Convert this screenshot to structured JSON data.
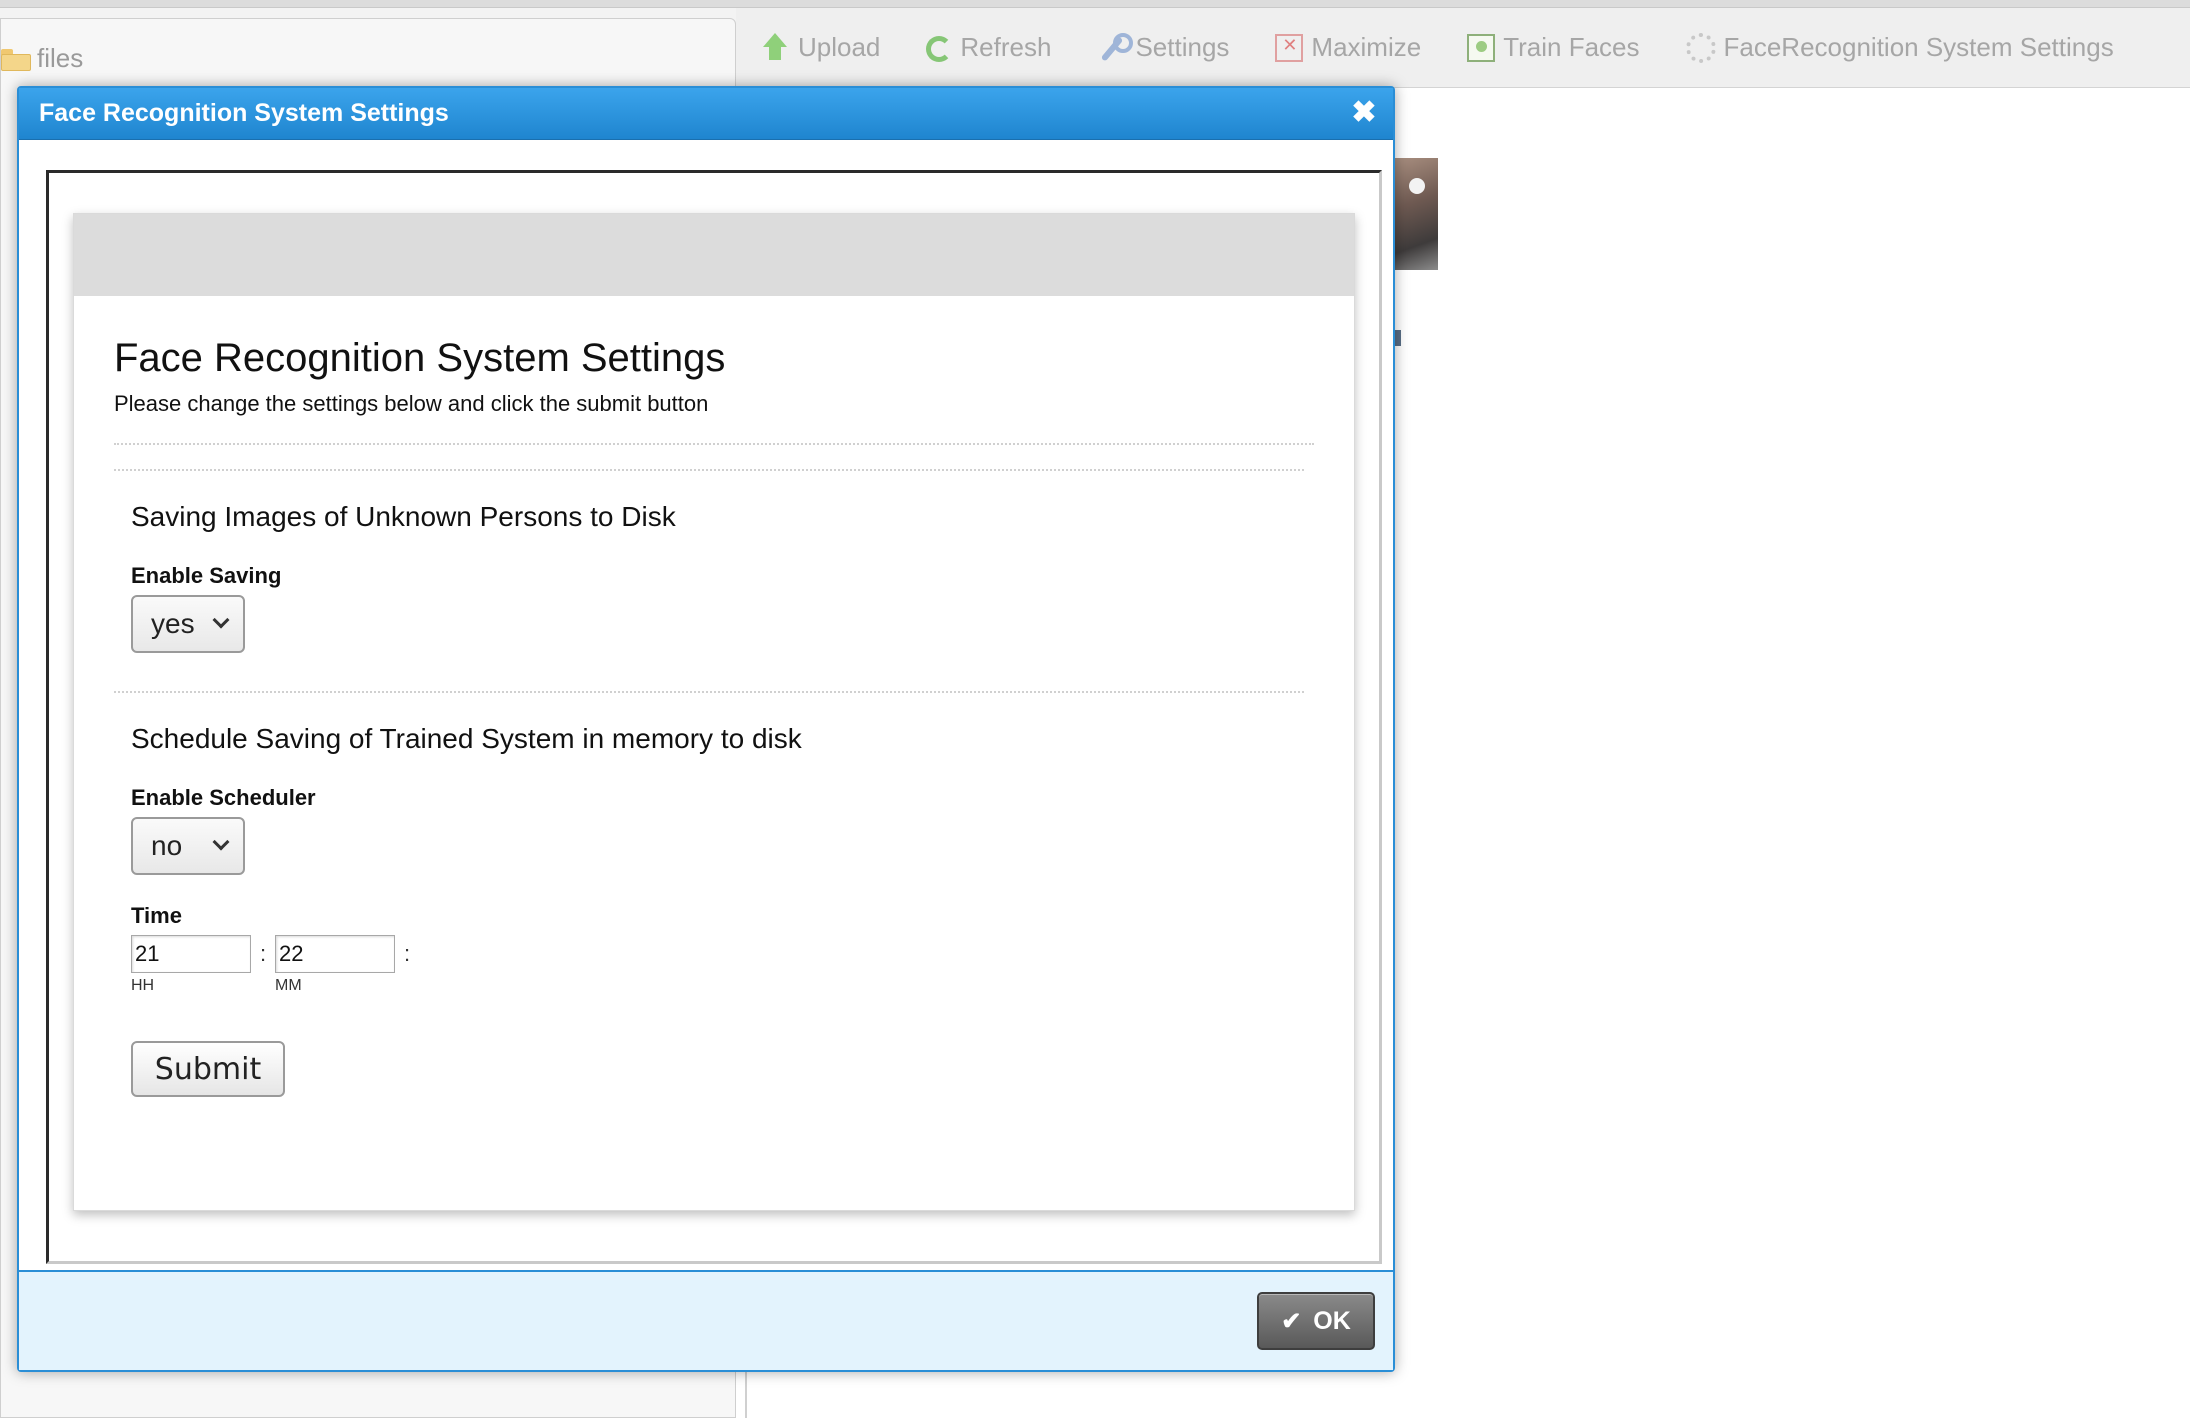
{
  "left_panel": {
    "root_folder": "files"
  },
  "toolbar": {
    "items": [
      {
        "label": "Upload",
        "icon": "upload-icon"
      },
      {
        "label": "Refresh",
        "icon": "refresh-icon"
      },
      {
        "label": "Settings",
        "icon": "wrench-icon"
      },
      {
        "label": "Maximize",
        "icon": "maximize-icon"
      },
      {
        "label": "Train Faces",
        "icon": "train-faces-icon"
      },
      {
        "label": "FaceRecognition System Settings",
        "icon": "gear-icon"
      }
    ]
  },
  "dialog": {
    "title": "Face Recognition System Settings",
    "close_icon": "close-icon",
    "form": {
      "title": "Face Recognition System Settings",
      "description": "Please change the settings below and click the submit button",
      "section_saving": {
        "title": "Saving Images of Unknown Persons to Disk",
        "label": "Enable Saving",
        "value": "yes"
      },
      "section_scheduler": {
        "title": "Schedule Saving of Trained System in memory to disk",
        "label": "Enable Scheduler",
        "value": "no",
        "time_label": "Time",
        "hours": "21",
        "minutes": "22",
        "separator": ":",
        "hours_hint": "HH",
        "minutes_hint": "MM"
      },
      "submit_label": "Submit"
    },
    "footer": {
      "ok_label": "OK",
      "ok_icon": "check-icon"
    }
  },
  "colors": {
    "dialog_accent": "#2a8ed6",
    "footer_bg": "#e3f3fd",
    "card_header_bg": "#dcdcdc"
  }
}
